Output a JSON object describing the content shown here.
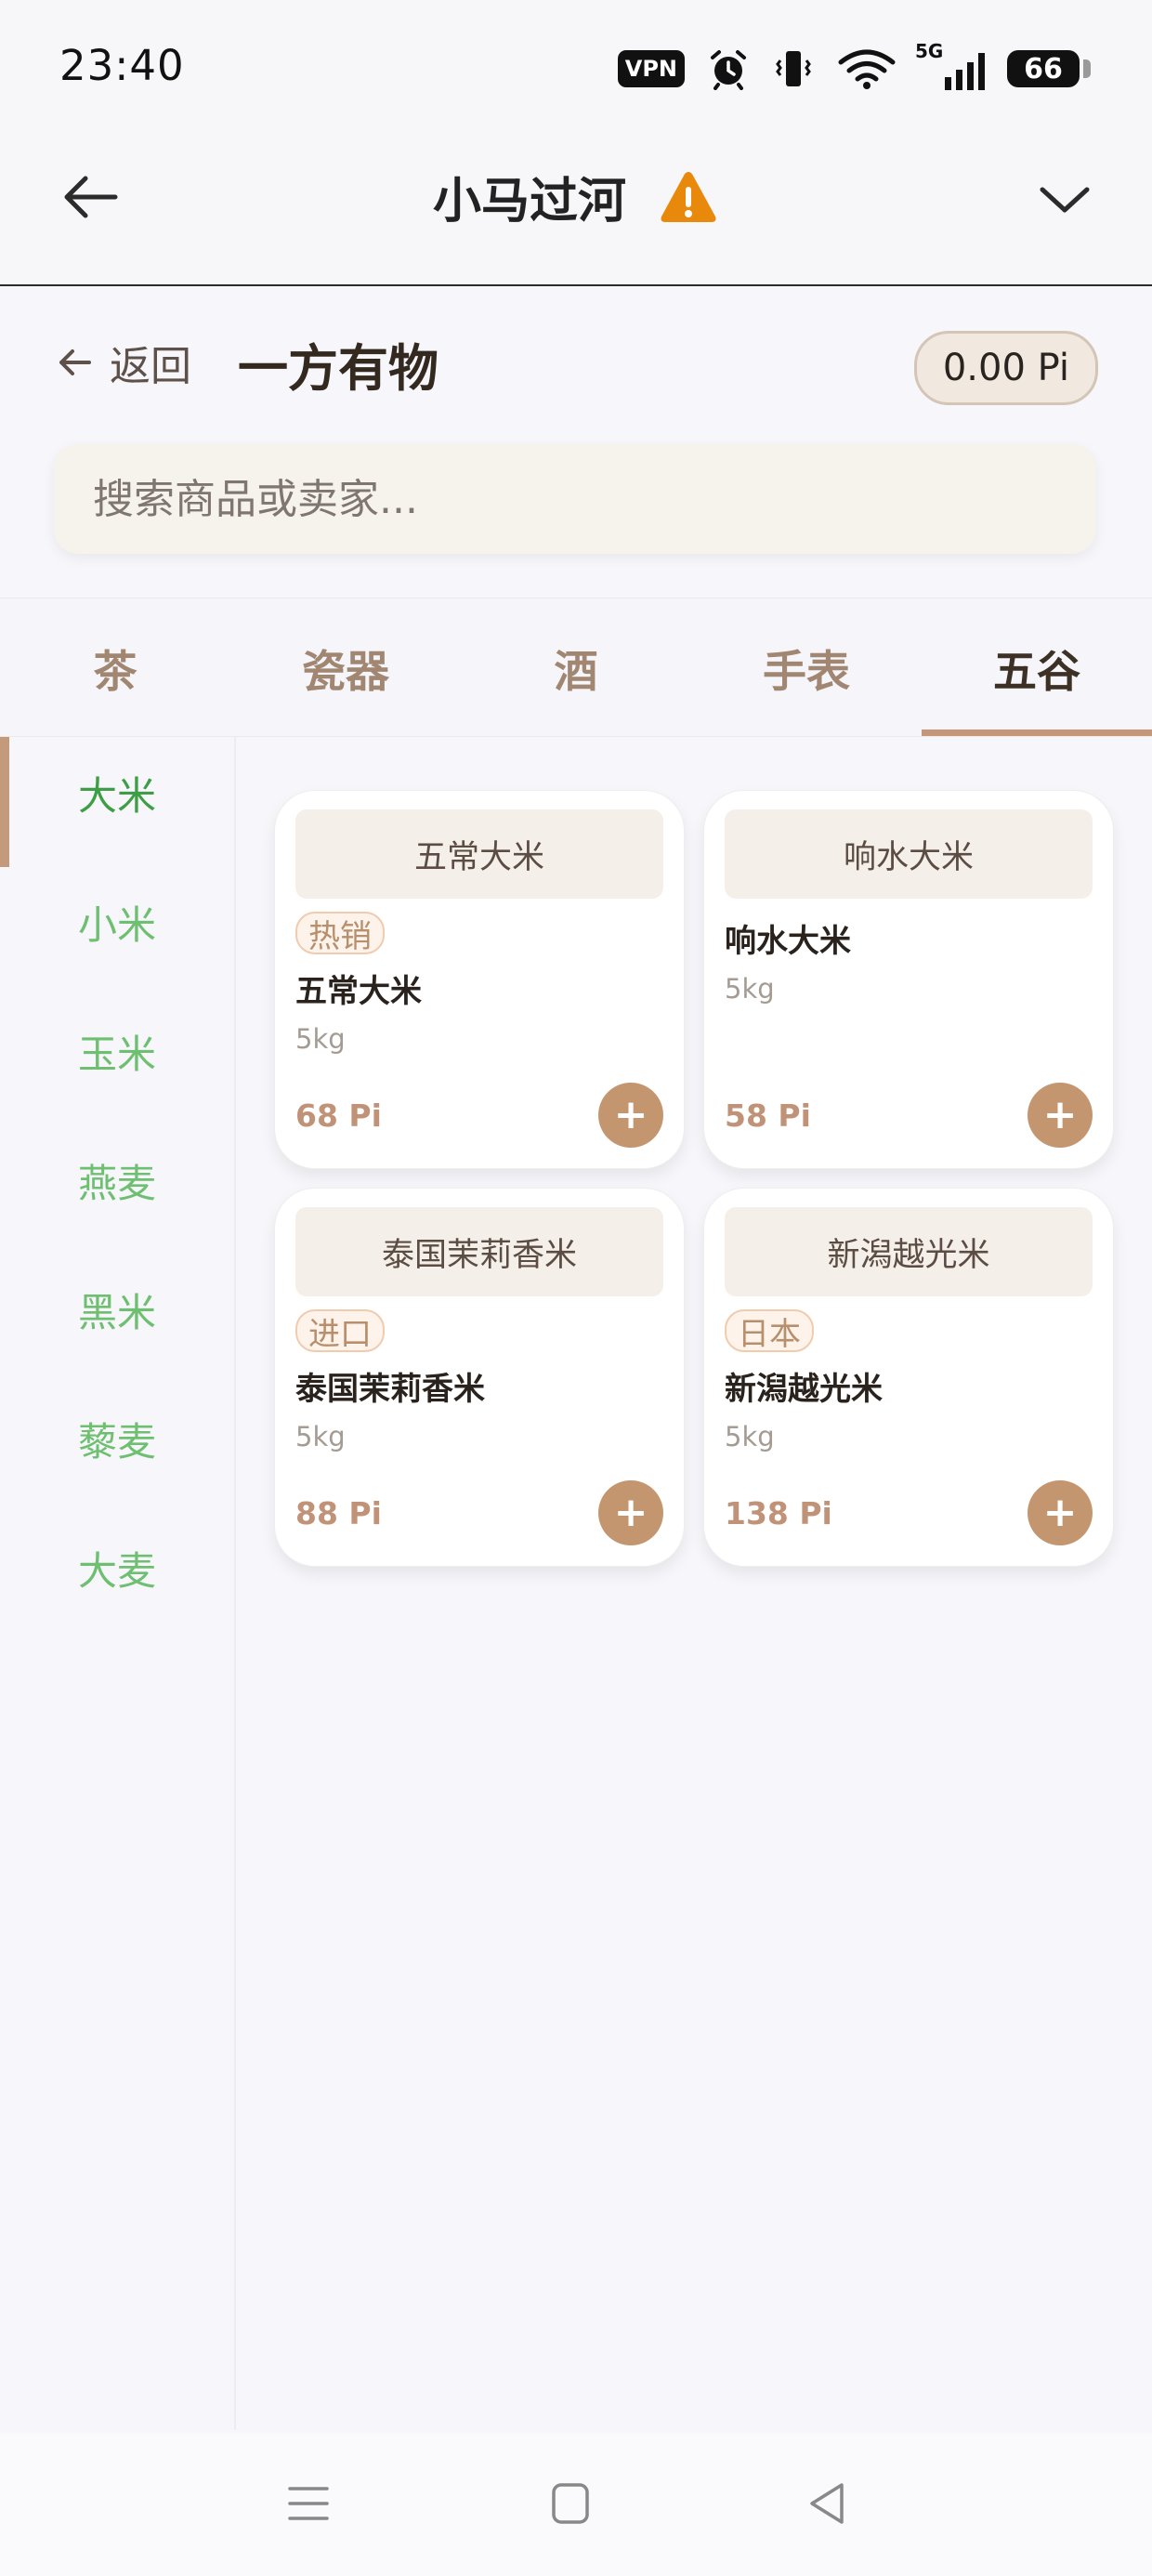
{
  "status_bar": {
    "time": "23:40",
    "vpn_label": "VPN",
    "network_label": "5G",
    "battery_level": "66",
    "icons": [
      "alarm-icon",
      "vibrate-icon",
      "wifi-icon",
      "signal-icon",
      "battery-icon"
    ]
  },
  "nav": {
    "title": "小马过河",
    "icons": [
      "arrow-left-icon",
      "warning-icon",
      "chevron-down-icon"
    ],
    "warning_color": "#E8890C"
  },
  "page": {
    "back_label": "返回",
    "shop_title": "一方有物",
    "balance": "0.00 Pi"
  },
  "search": {
    "placeholder": "搜索商品或卖家...",
    "value": ""
  },
  "categories": {
    "tabs": [
      "茶",
      "瓷器",
      "酒",
      "手表",
      "五谷"
    ],
    "active_index": 4
  },
  "subcategories": {
    "items": [
      "大米",
      "小米",
      "玉米",
      "燕麦",
      "黑米",
      "藜麦",
      "大麦"
    ],
    "active_index": 0
  },
  "products": [
    {
      "image_label": "五常大米",
      "tag": "热销",
      "name": "五常大米",
      "unit": "5kg",
      "price": "68 Pi"
    },
    {
      "image_label": "响水大米",
      "tag": "",
      "name": "响水大米",
      "unit": "5kg",
      "price": "58 Pi"
    },
    {
      "image_label": "泰国茉莉香米",
      "tag": "进口",
      "name": "泰国茉莉香米",
      "unit": "5kg",
      "price": "88 Pi"
    },
    {
      "image_label": "新潟越光米",
      "tag": "日本",
      "name": "新潟越光米",
      "unit": "5kg",
      "price": "138 Pi"
    }
  ],
  "add_label": "+",
  "bottom_nav": {
    "icons": [
      "menu-icon",
      "home-square-icon",
      "back-triangle-icon"
    ]
  },
  "colors": {
    "accent": "#C4967A",
    "subcategory_green": "#6EBF70",
    "price": "#C09277"
  }
}
